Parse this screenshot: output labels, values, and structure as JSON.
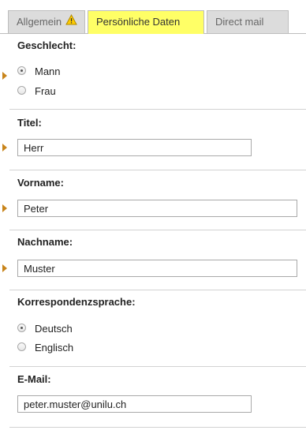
{
  "tabs": [
    {
      "label": "Allgemein",
      "has_warning": true
    },
    {
      "label": "Persönliche Daten",
      "active": true
    },
    {
      "label": "Direct mail"
    }
  ],
  "form": {
    "gender": {
      "label": "Geschlecht:",
      "options": [
        {
          "label": "Mann",
          "checked": true
        },
        {
          "label": "Frau",
          "checked": false
        }
      ]
    },
    "title": {
      "label": "Titel:",
      "value": "Herr"
    },
    "firstname": {
      "label": "Vorname:",
      "value": "Peter"
    },
    "lastname": {
      "label": "Nachname:",
      "value": "Muster"
    },
    "language": {
      "label": "Korrespondenzsprache:",
      "options": [
        {
          "label": "Deutsch",
          "checked": true
        },
        {
          "label": "Englisch",
          "checked": false
        }
      ]
    },
    "email": {
      "label": "E-Mail:",
      "value": "peter.muster@unilu.ch"
    }
  },
  "colors": {
    "active_tab": "#ffff66",
    "inactive_tab": "#dcdcdc",
    "marker": "#c8841a",
    "warning": "#ffcc00"
  }
}
